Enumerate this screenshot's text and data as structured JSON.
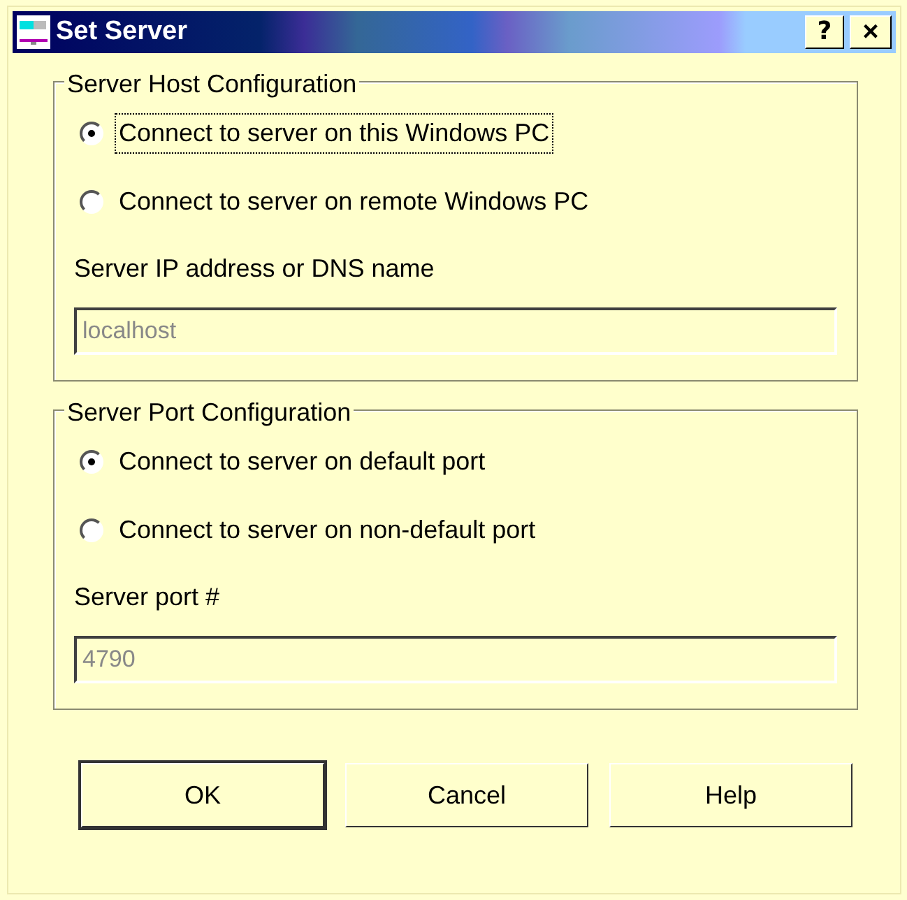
{
  "window": {
    "title": "Set Server",
    "buttons": [
      {
        "kind": "help",
        "label": "?"
      },
      {
        "kind": "close",
        "label": "×"
      }
    ]
  },
  "groups": [
    {
      "title": "Server Host Configuration",
      "options": [
        {
          "label": "Connect to server on this Windows PC",
          "selected": true,
          "focused": true
        },
        {
          "label": "Connect to server on remote Windows PC",
          "selected": false,
          "focused": false
        }
      ],
      "field_label": "Server IP address or DNS name",
      "field_value": "localhost",
      "field_disabled": true
    },
    {
      "title": "Server Port Configuration",
      "options": [
        {
          "label": "Connect to server on default port",
          "selected": true,
          "focused": false
        },
        {
          "label": "Connect to server on non-default port",
          "selected": false,
          "focused": false
        }
      ],
      "field_label": "Server port #",
      "field_value": "4790",
      "field_disabled": true
    }
  ],
  "buttons": [
    {
      "label": "OK",
      "default": true
    },
    {
      "label": "Cancel",
      "default": false
    },
    {
      "label": "Help",
      "default": false
    }
  ]
}
